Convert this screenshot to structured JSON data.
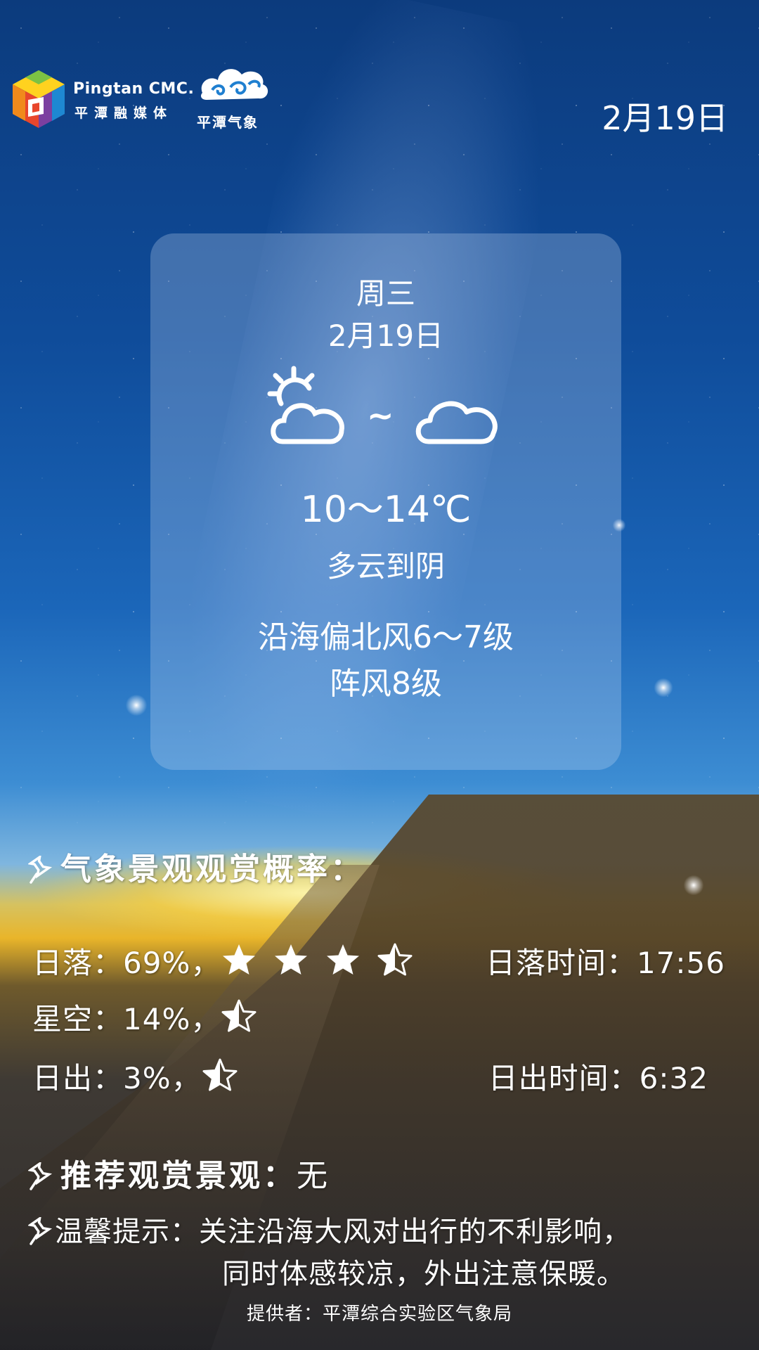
{
  "branding": {
    "media_en": "Pingtan CMC.",
    "media_cn": "平潭融媒体",
    "weather_brand": "平潭气象"
  },
  "header": {
    "date": "2月19日"
  },
  "forecast": {
    "weekday": "周三",
    "date": "2月19日",
    "icon_from": "partly-cloudy-icon",
    "tilde": "~",
    "icon_to": "cloudy-icon",
    "temperature": "10～14℃",
    "condition": "多云到阴",
    "wind": "沿海偏北风6～7级",
    "gust": "阵风8级"
  },
  "landscape": {
    "title": "气象景观观赏概率：",
    "items": [
      {
        "label": "日落：69%，",
        "stars": 3.5
      },
      {
        "label": "星空：14%，",
        "stars": 0.5
      },
      {
        "label": "日出：3%，",
        "stars": 0.5
      }
    ],
    "sunset_time": "日落时间：17:56",
    "sunrise_time": "日出时间：6:32"
  },
  "recommendation": {
    "label": "推荐观赏景观：",
    "value": "无"
  },
  "tip": {
    "label": "温馨提示：",
    "line1": "关注沿海大风对出行的不利影响，",
    "line2": "同时体感较凉，外出注意保暖。"
  },
  "footer": {
    "provider": "提供者：平潭综合实验区气象局"
  },
  "colors": {
    "text": "#ffffff",
    "sky_top": "#0c3b7d",
    "sunset": "#e9b52a"
  }
}
